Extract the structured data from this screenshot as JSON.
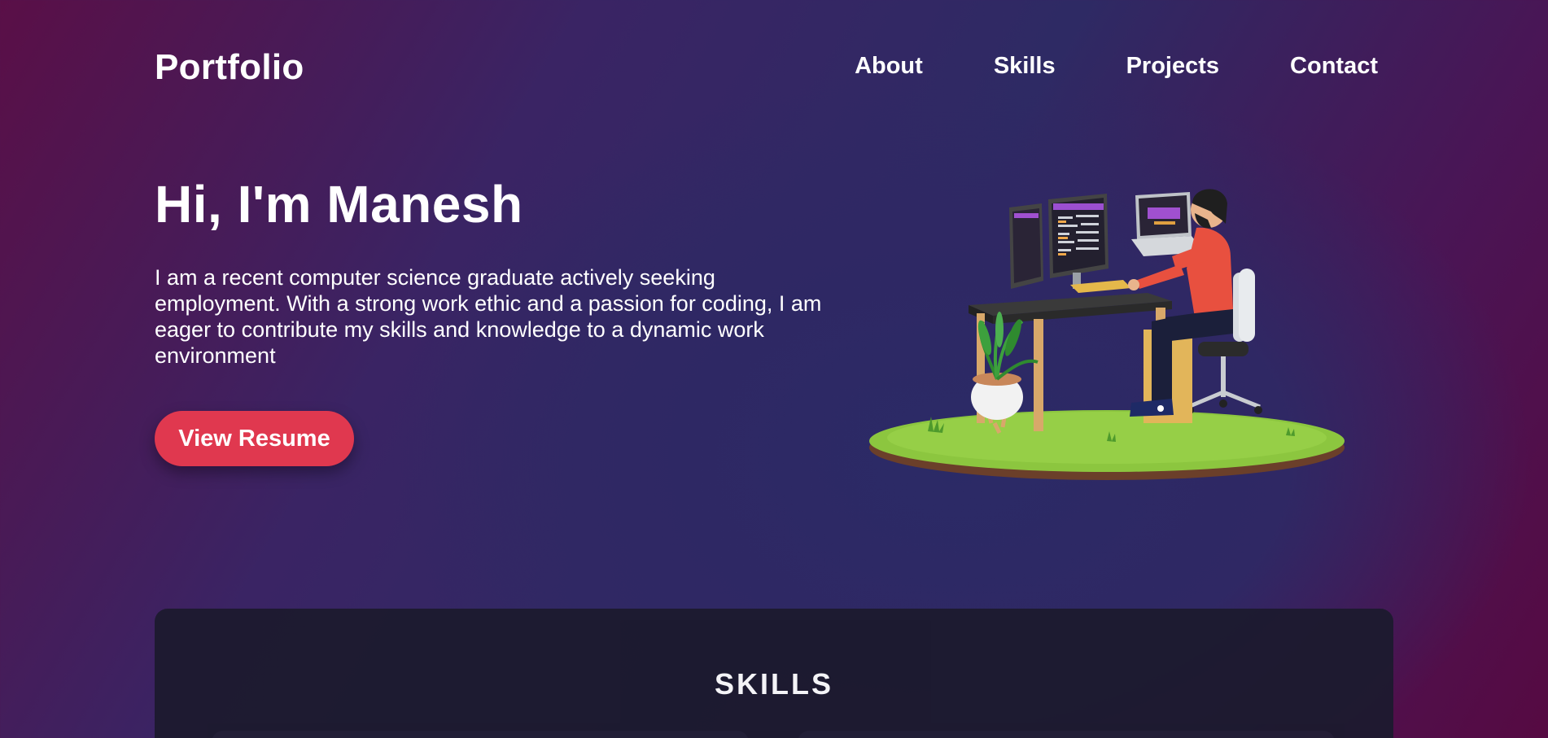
{
  "header": {
    "logo": "Portfolio",
    "nav": [
      "About",
      "Skills",
      "Projects",
      "Contact"
    ]
  },
  "hero": {
    "title": "Hi, I'm Manesh",
    "description": "I am a recent computer science graduate actively seeking employment. With a strong work ethic and a passion for coding, I am eager to contribute my skills and knowledge to a dynamic work environment",
    "button_label": "View Resume"
  },
  "skills": {
    "title": "SKILLS"
  },
  "colors": {
    "accent": "#e0384f",
    "card_bg": "#1c1a2e",
    "text": "#ffffff"
  }
}
